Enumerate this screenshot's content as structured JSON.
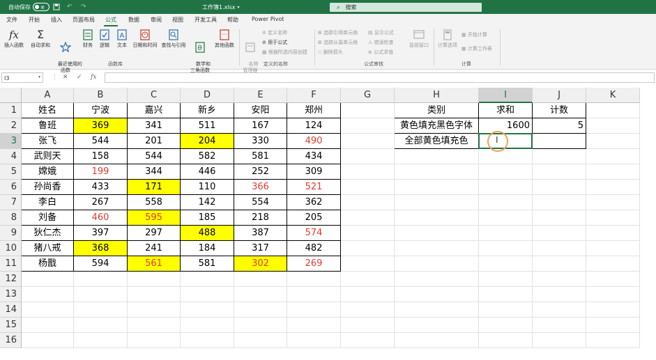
{
  "titlebar": {
    "autosave_label": "自动保存",
    "autosave_state": "关",
    "filename": "工作簿1.xlsx",
    "search_placeholder": "搜索"
  },
  "tabs": [
    "文件",
    "开始",
    "插入",
    "页面布局",
    "公式",
    "数据",
    "审阅",
    "视图",
    "开发工具",
    "帮助",
    "Power Pivot"
  ],
  "active_tab": "公式",
  "ribbon": {
    "function_library": {
      "buttons": [
        "插入函数",
        "自动求和",
        "最近使用的\n函数",
        "财务",
        "逻辑",
        "文本",
        "日期和时间",
        "查找与引用",
        "数学和\n三角函数",
        "其他函数"
      ],
      "group_label": "函数库"
    },
    "defined_names": {
      "big_button": "名称\n管理器",
      "items": [
        "定义名称",
        "用于公式",
        "根据所选内容创建"
      ],
      "group_label": "定义的名称"
    },
    "formula_auditing": {
      "items": [
        "追踪引用单元格",
        "追踪从属单元格",
        "删除箭头",
        "显示公式",
        "错误检查",
        "公式求值"
      ],
      "watch_window": "监视窗口",
      "group_label": "公式审核"
    },
    "calculation": {
      "options": "计算选项",
      "items": [
        "开始计算",
        "计算工作表"
      ],
      "group_label": "计算"
    }
  },
  "formula_bar": {
    "name_box": "I3",
    "fx": "fx",
    "formula": ""
  },
  "columns": [
    "A",
    "B",
    "C",
    "D",
    "E",
    "F",
    "G",
    "H",
    "I",
    "J",
    "K"
  ],
  "selected_column": "I",
  "rows": [
    "1",
    "2",
    "3",
    "4",
    "5",
    "6",
    "7",
    "8",
    "9",
    "10",
    "11",
    "12",
    "13",
    "14",
    "15",
    "16"
  ],
  "selected_row": "3",
  "table": {
    "header": [
      "姓名",
      "宁波",
      "嘉兴",
      "新乡",
      "安阳",
      "郑州"
    ],
    "data": [
      [
        "鲁班",
        "369",
        "341",
        "511",
        "167",
        "124"
      ],
      [
        "张飞",
        "544",
        "201",
        "204",
        "330",
        "490"
      ],
      [
        "武则天",
        "158",
        "544",
        "582",
        "581",
        "434"
      ],
      [
        "嫦娥",
        "199",
        "344",
        "446",
        "252",
        "309"
      ],
      [
        "孙尚香",
        "433",
        "171",
        "110",
        "366",
        "521"
      ],
      [
        "李白",
        "267",
        "558",
        "142",
        "554",
        "362"
      ],
      [
        "刘备",
        "460",
        "595",
        "185",
        "218",
        "205"
      ],
      [
        "狄仁杰",
        "397",
        "297",
        "488",
        "387",
        "574"
      ],
      [
        "猪八戒",
        "368",
        "241",
        "184",
        "317",
        "482"
      ],
      [
        "杨戬",
        "594",
        "561",
        "581",
        "302",
        "269"
      ]
    ],
    "styles": [
      [
        "",
        "Y",
        "",
        "",
        "",
        ""
      ],
      [
        "",
        "",
        "",
        "Y",
        "",
        "R"
      ],
      [
        "",
        "",
        "",
        "",
        "",
        ""
      ],
      [
        "",
        "R",
        "",
        "",
        "",
        ""
      ],
      [
        "",
        "",
        "Y",
        "",
        "R",
        "R"
      ],
      [
        "",
        "",
        "",
        "",
        "",
        ""
      ],
      [
        "",
        "R",
        "YR",
        "",
        "",
        ""
      ],
      [
        "",
        "",
        "",
        "Y",
        "",
        "R"
      ],
      [
        "",
        "Y",
        "",
        "",
        "",
        ""
      ],
      [
        "",
        "",
        "YR",
        "",
        "YR",
        "R"
      ]
    ]
  },
  "summary": {
    "header": [
      "类别",
      "求和",
      "计数"
    ],
    "rows": [
      [
        "黄色填充黑色字体",
        "1600",
        "5"
      ],
      [
        "全部黄色填充色",
        "",
        ""
      ]
    ]
  },
  "colors": {
    "excel_green": "#217346",
    "yellow_fill": "#ffff00",
    "red_font": "#e03a2e"
  }
}
